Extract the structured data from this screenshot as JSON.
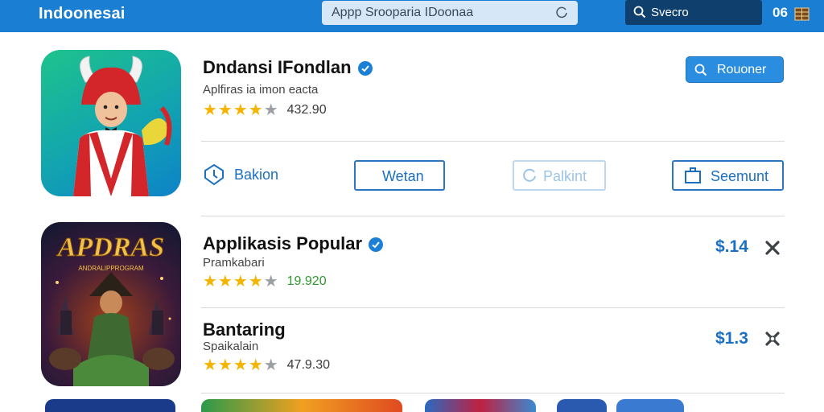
{
  "header": {
    "brand": "Indoonesai",
    "address": "Appp Srooparia IDoonaa",
    "search_label": "Svecro",
    "counter": "06"
  },
  "apps": [
    {
      "title": "Dndansi IFondlan",
      "verified": true,
      "subtitle": "Aplfiras ia imon eacta",
      "rating_value": "432.90",
      "stars": 4.5,
      "primary_button": "Rouoner",
      "actions": [
        "Bakion",
        "Wetan",
        "Palkint",
        "Seemunt"
      ]
    },
    {
      "title": "Applikasis Popular",
      "verified": true,
      "subtitle": "Pramkabari",
      "rating_value": "19.920",
      "stars": 4.5,
      "price": "$.14",
      "icon_text": "APDRAS",
      "icon_subtext": "ANDRALIPPROGRAM"
    },
    {
      "title": "Bantaring",
      "verified": false,
      "subtitle": "Spaikalain",
      "rating_value": "47.9.30",
      "stars": 4.5,
      "price": "$1.3"
    }
  ],
  "colors": {
    "topbar": "#1a7fd3",
    "accent": "#1b6fc0",
    "star": "#f5b400",
    "rating_green": "#2e9a2e"
  },
  "icons": [
    "reload-icon",
    "search-icon",
    "box-icon",
    "verified-icon",
    "shield-icon",
    "refresh-icon",
    "share-icon",
    "close-icon",
    "sparkle-icon"
  ]
}
